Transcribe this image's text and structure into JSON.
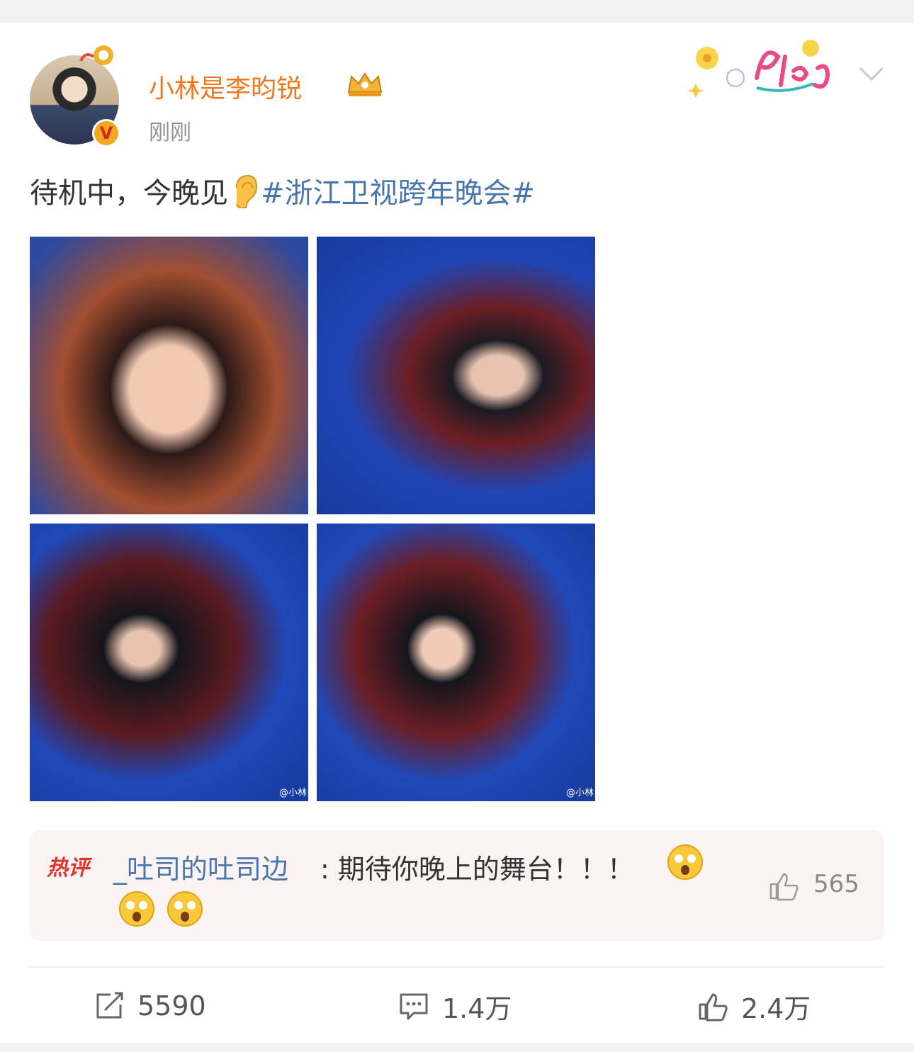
{
  "user": {
    "name": "小林是李昀锐",
    "time": "刚刚",
    "avatar_icon": "avatar-icon",
    "verified_label": "V"
  },
  "post": {
    "text": "待机中，今晚见",
    "hashtag": "#浙江卫视跨年晚会#"
  },
  "photos": {
    "watermark_3": "@小林",
    "watermark_4": "@小林"
  },
  "hot_comment": {
    "badge": "热评",
    "user": "_吐司的吐司边",
    "text": ": 期待你晚上的舞台！！！",
    "likes": "565"
  },
  "actions": {
    "repost_count": "5590",
    "comment_count": "1.4万",
    "like_count": "2.4万"
  },
  "colors": {
    "username": "#f0781e",
    "hashtag": "#4a76b0",
    "hot_badge": "#e0352b"
  }
}
